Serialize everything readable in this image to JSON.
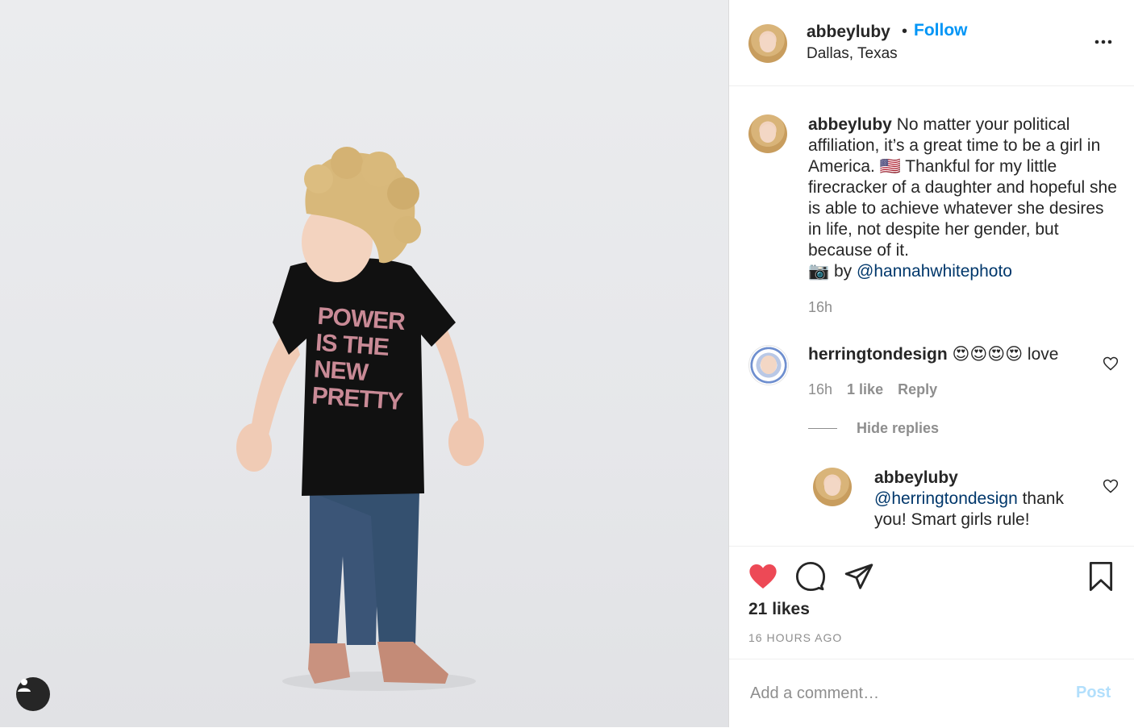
{
  "post": {
    "author": "abbeyluby",
    "separator": "•",
    "follow_label": "Follow",
    "location": "Dallas, Texas",
    "more_icon": "more-horizontal-icon",
    "shirt_text": [
      "POWER",
      "IS THE",
      "NEW",
      "PRETTY"
    ]
  },
  "caption": {
    "username": "abbeyluby",
    "text_1": "No matter your political affiliation, it’s a great time to be a girl in America. 🇺🇸 Thankful for my little firecracker of a daughter and hopeful she is able to achieve whatever she desires in life, not despite her gender, but because of it.",
    "text_2": "📷 by",
    "mention": "@hannahwhitephoto",
    "time": "16h"
  },
  "comments": [
    {
      "username": "herringtondesign",
      "text": "😍😍😍😍 love",
      "time": "16h",
      "likes": "1 like",
      "reply_label": "Reply"
    }
  ],
  "hide_replies_label": "Hide replies",
  "reply": {
    "username": "abbeyluby",
    "mention": "@herringtondesign",
    "text": " thank you! Smart girls rule!"
  },
  "actions": {
    "likes": "21 likes",
    "timestamp": "16 HOURS AGO",
    "like_color": "#ed4956"
  },
  "add_comment": {
    "placeholder": "Add a comment…",
    "post_label": "Post"
  },
  "colors": {
    "accent": "#0095f6",
    "mention": "#00376b",
    "muted": "#8e8e8e"
  }
}
